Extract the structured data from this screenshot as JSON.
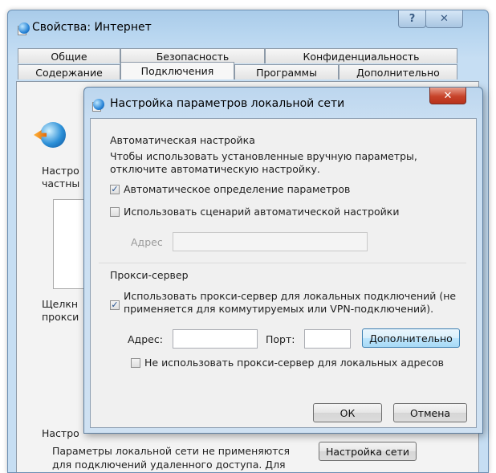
{
  "outer_window": {
    "title": "Свойства: Интернет",
    "help_glyph": "?",
    "close_glyph": "✕",
    "tabs_row1": [
      "Общие",
      "Безопасность",
      "Конфиденциальность"
    ],
    "tabs_row2": [
      "Содержание",
      "Подключения",
      "Программы",
      "Дополнительно"
    ],
    "active_tab": "Подключения",
    "bg_fragments": {
      "setup_1": "Настро",
      "setup_2": "частны",
      "click_1": "Щелкн",
      "click_2": "прокси",
      "lan_section": "Настро"
    },
    "lan_settings_button": "Настройка сети",
    "bottom_text_1": "Параметры локальной сети не применяются",
    "bottom_text_2": "для подключений удаленного доступа. Для"
  },
  "lan_dialog": {
    "title": "Настройка параметров локальной сети",
    "close_glyph": "✕",
    "auto": {
      "title": "Автоматическая настройка",
      "description_1": "Чтобы использовать установленные вручную параметры,",
      "description_2": "отключите автоматическую настройку.",
      "auto_detect_label": "Автоматическое определение параметров",
      "auto_detect_checked": true,
      "script_label": "Использовать сценарий автоматической настройки",
      "script_checked": false,
      "address_label": "Адрес",
      "address_value": ""
    },
    "proxy": {
      "title": "Прокси-сервер",
      "use_proxy_label_1": "Использовать прокси-сервер для локальных подключений (не",
      "use_proxy_label_2": "применяется для коммутируемых или VPN-подключений).",
      "use_proxy_checked": true,
      "address_label": "Адрес:",
      "address_value": "",
      "port_label": "Порт:",
      "port_value": "",
      "advanced_button": "Дополнительно",
      "bypass_label": "Не использовать прокси-сервер для локальных адресов",
      "bypass_checked": false
    },
    "ok_button": "ОК",
    "cancel_button": "Отмена"
  }
}
